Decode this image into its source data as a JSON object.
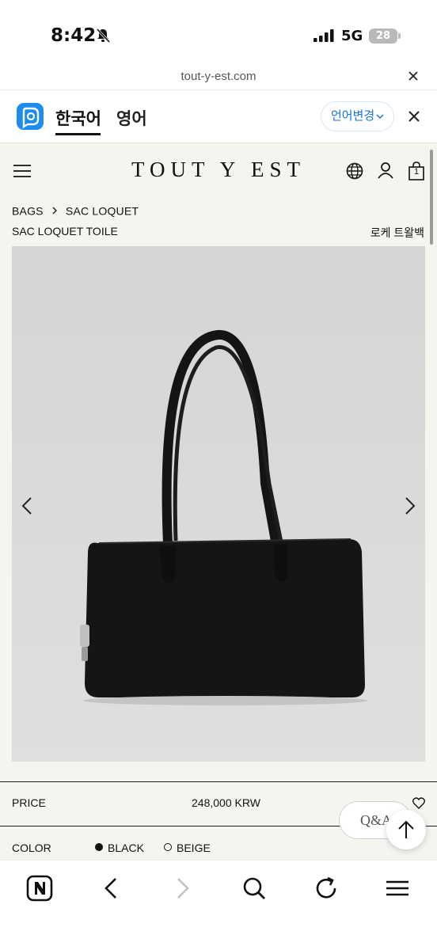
{
  "status_bar": {
    "time": "8:42",
    "network": "5G",
    "battery": "28"
  },
  "browser": {
    "url": "tout-y-est.com"
  },
  "translate_bar": {
    "lang_source": "한국어",
    "lang_target": "영어",
    "change_label": "언어변경"
  },
  "site": {
    "logo": "TOUT Y EST",
    "cart_count": "1",
    "breadcrumb": [
      "BAGS",
      "SAC LOQUET"
    ],
    "product_name": "SAC LOQUET TOILE",
    "product_name_kr": "로케 트왈백",
    "price_label": "PRICE",
    "price_value": "248,000 KRW",
    "color_label": "COLOR",
    "color_options": [
      "BLACK",
      "BEIGE"
    ],
    "qa_label": "Q&A"
  },
  "colors": {
    "site_background": "#f6f4ef",
    "photo_background": "#d9d9d9",
    "bag": "#111111",
    "papago_blue": "#1c8cf0",
    "link_blue": "#1a73d9"
  },
  "icons": {
    "toolbar": [
      "naver-n-icon",
      "back-arrow-icon",
      "forward-arrow-icon",
      "search-icon",
      "refresh-icon",
      "menu-icon"
    ]
  }
}
